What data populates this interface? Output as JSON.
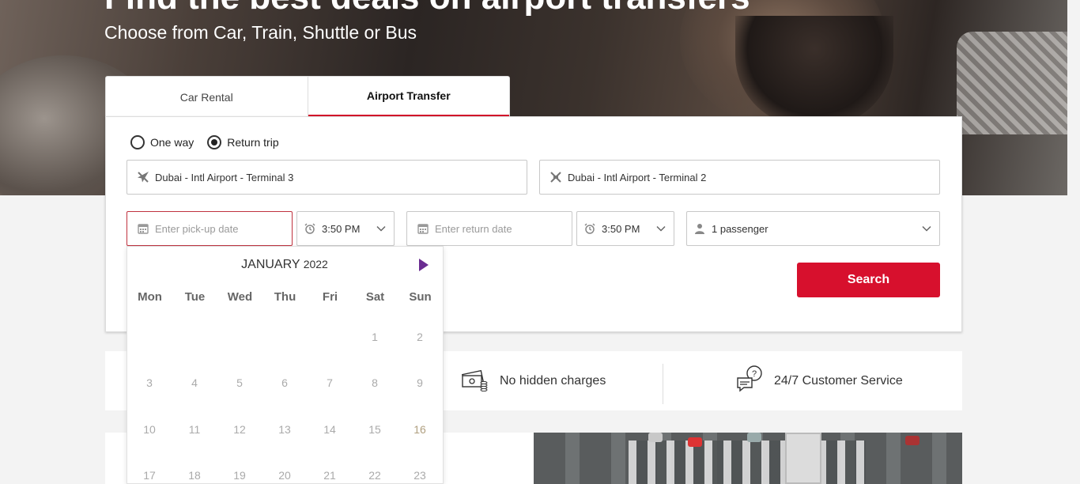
{
  "hero": {
    "title": "Find the best deals on airport transfers",
    "subtitle": "Choose from Car, Train, Shuttle or Bus"
  },
  "tabs": [
    {
      "label": "Car Rental",
      "active": false
    },
    {
      "label": "Airport Transfer",
      "active": true
    }
  ],
  "trip_type": {
    "options": [
      {
        "label": "One way",
        "checked": false
      },
      {
        "label": "Return trip",
        "checked": true
      }
    ]
  },
  "pickup_location": {
    "value": "Dubai - Intl Airport - Terminal 3",
    "icon": "plane-icon"
  },
  "dropoff_location": {
    "value": "Dubai - Intl Airport - Terminal 2",
    "icon": "plane-icon"
  },
  "pickup_date": {
    "placeholder": "Enter pick-up date",
    "icon": "calendar-icon"
  },
  "pickup_time": {
    "value": "3:50 PM",
    "icon": "alarm-clock-icon"
  },
  "return_date": {
    "placeholder": "Enter return date",
    "icon": "calendar-icon"
  },
  "return_time": {
    "value": "3:50 PM",
    "icon": "alarm-clock-icon"
  },
  "passengers": {
    "value": "1 passenger",
    "icon": "person-icon"
  },
  "search_button": {
    "label": "Search"
  },
  "colors": {
    "accent": "#d7102d",
    "calendar_nav": "#6a2c91"
  },
  "features": [
    {
      "label": "No hidden charges",
      "icon": "money-icon"
    },
    {
      "label": "24/7 Customer Service",
      "icon": "support-chat-icon"
    }
  ],
  "calendar": {
    "month": "JANUARY",
    "year": "2022",
    "weekdays": [
      "Mon",
      "Tue",
      "Wed",
      "Thu",
      "Fri",
      "Sat",
      "Sun"
    ],
    "weeks": [
      [
        "",
        "",
        "",
        "",
        "",
        "1",
        "2"
      ],
      [
        "3",
        "4",
        "5",
        "6",
        "7",
        "8",
        "9"
      ],
      [
        "10",
        "11",
        "12",
        "13",
        "14",
        "15",
        "16"
      ],
      [
        "17",
        "18",
        "19",
        "20",
        "21",
        "22",
        "23"
      ]
    ]
  }
}
